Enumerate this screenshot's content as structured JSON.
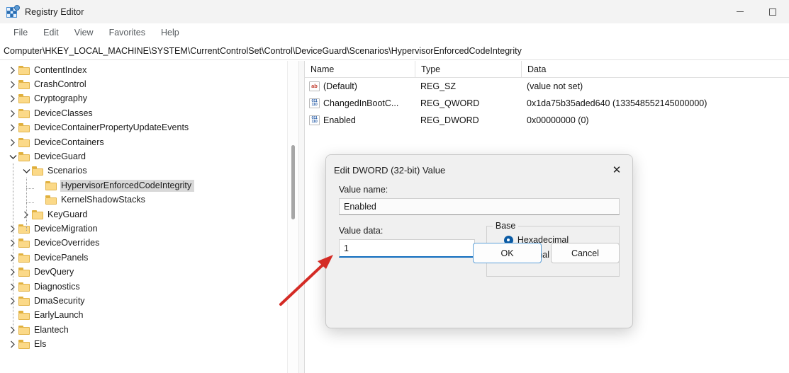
{
  "window": {
    "title": "Registry Editor",
    "icon": "registry-editor-icon",
    "controls": {
      "minimize": "—",
      "maximize": "□"
    }
  },
  "menubar": {
    "items": [
      "File",
      "Edit",
      "View",
      "Favorites",
      "Help"
    ]
  },
  "address": {
    "path": "Computer\\HKEY_LOCAL_MACHINE\\SYSTEM\\CurrentControlSet\\Control\\DeviceGuard\\Scenarios\\HypervisorEnforcedCodeIntegrity"
  },
  "tree": {
    "items": [
      {
        "label": "ContentIndex",
        "depth": 1,
        "expander": "collapsed",
        "selected": false
      },
      {
        "label": "CrashControl",
        "depth": 1,
        "expander": "collapsed",
        "selected": false
      },
      {
        "label": "Cryptography",
        "depth": 1,
        "expander": "collapsed",
        "selected": false
      },
      {
        "label": "DeviceClasses",
        "depth": 1,
        "expander": "collapsed",
        "selected": false
      },
      {
        "label": "DeviceContainerPropertyUpdateEvents",
        "depth": 1,
        "expander": "collapsed",
        "selected": false
      },
      {
        "label": "DeviceContainers",
        "depth": 1,
        "expander": "collapsed",
        "selected": false
      },
      {
        "label": "DeviceGuard",
        "depth": 1,
        "expander": "expanded",
        "selected": false
      },
      {
        "label": "Scenarios",
        "depth": 2,
        "expander": "expanded",
        "selected": false
      },
      {
        "label": "HypervisorEnforcedCodeIntegrity",
        "depth": 3,
        "expander": "none",
        "selected": true
      },
      {
        "label": "KernelShadowStacks",
        "depth": 3,
        "expander": "none",
        "selected": false
      },
      {
        "label": "KeyGuard",
        "depth": 2,
        "expander": "collapsed",
        "selected": false
      },
      {
        "label": "DeviceMigration",
        "depth": 1,
        "expander": "collapsed",
        "selected": false
      },
      {
        "label": "DeviceOverrides",
        "depth": 1,
        "expander": "collapsed",
        "selected": false
      },
      {
        "label": "DevicePanels",
        "depth": 1,
        "expander": "collapsed",
        "selected": false
      },
      {
        "label": "DevQuery",
        "depth": 1,
        "expander": "collapsed",
        "selected": false
      },
      {
        "label": "Diagnostics",
        "depth": 1,
        "expander": "collapsed",
        "selected": false
      },
      {
        "label": "DmaSecurity",
        "depth": 1,
        "expander": "collapsed",
        "selected": false
      },
      {
        "label": "EarlyLaunch",
        "depth": 1,
        "expander": "none",
        "selected": false
      },
      {
        "label": "Elantech",
        "depth": 1,
        "expander": "collapsed",
        "selected": false
      },
      {
        "label": "Els",
        "depth": 1,
        "expander": "collapsed",
        "selected": false
      }
    ]
  },
  "list": {
    "columns": [
      "Name",
      "Type",
      "Data"
    ],
    "rows": [
      {
        "name": "(Default)",
        "type": "REG_SZ",
        "data": "(value not set)",
        "icon": "string-value-icon"
      },
      {
        "name": "ChangedInBootC...",
        "type": "REG_QWORD",
        "data": "0x1da75b35aded640 (133548552145000000)",
        "icon": "binary-value-icon"
      },
      {
        "name": "Enabled",
        "type": "REG_DWORD",
        "data": "0x00000000 (0)",
        "icon": "binary-value-icon"
      }
    ]
  },
  "dialog": {
    "title": "Edit DWORD (32-bit) Value",
    "close_icon": "✕",
    "value_name_label": "Value name:",
    "value_name": "Enabled",
    "value_data_label": "Value data:",
    "value_data": "1",
    "base_group_label": "Base",
    "base_options": [
      {
        "label": "Hexadecimal",
        "selected": true
      },
      {
        "label": "Decimal",
        "selected": false
      }
    ],
    "ok_label": "OK",
    "cancel_label": "Cancel"
  },
  "annotation": {
    "arrow_color": "#d42b25"
  }
}
